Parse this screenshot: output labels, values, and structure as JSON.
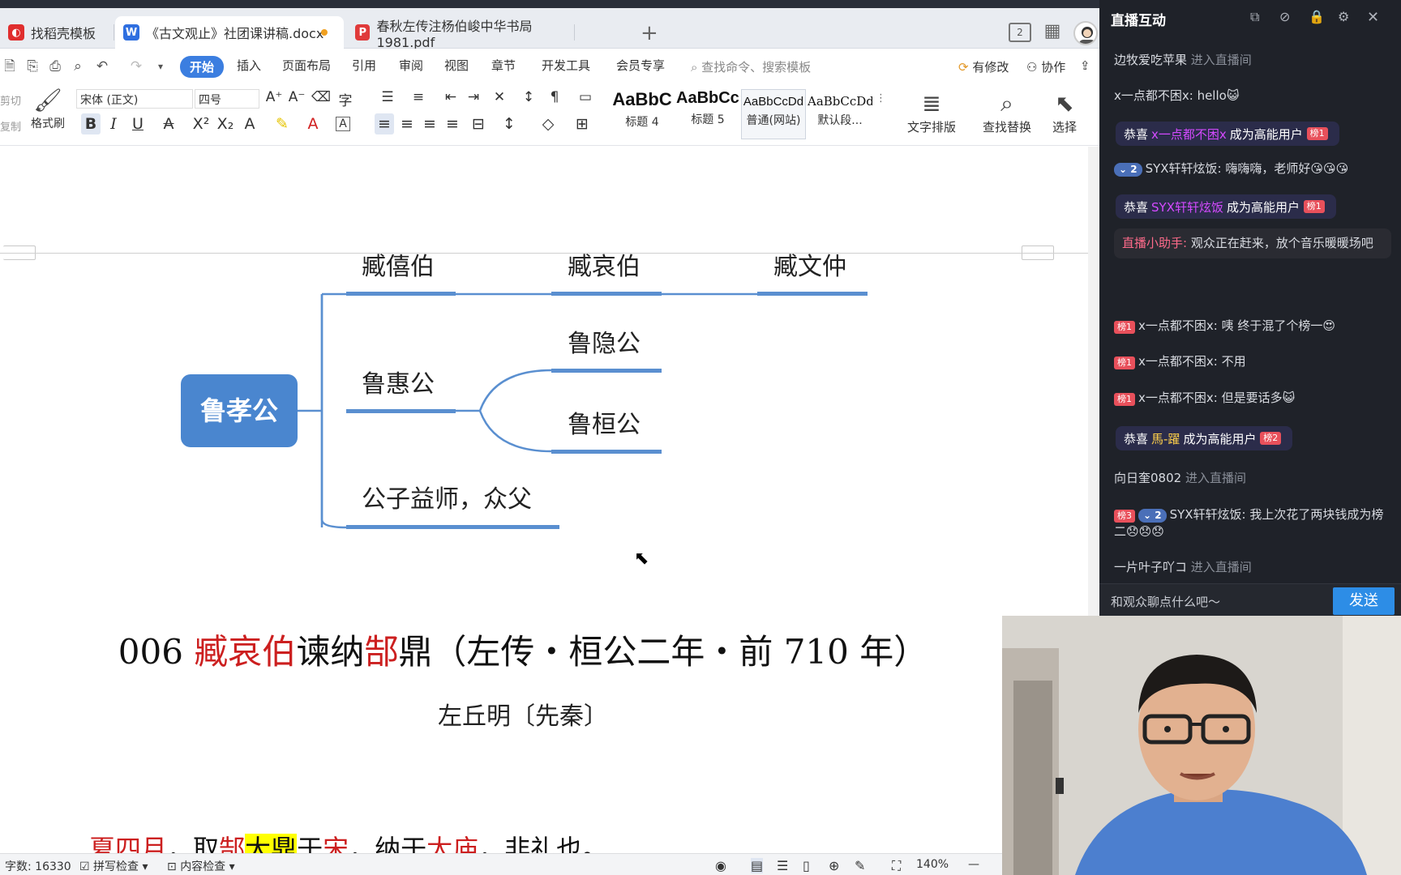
{
  "tabs": [
    {
      "label": "找稻壳模板",
      "icon_color": "#e02e2e",
      "icon": "稻"
    },
    {
      "label": "《古文观止》社团课讲稿.docx",
      "icon_color": "#2f6fe0",
      "icon": "W"
    },
    {
      "label": "春秋左传注杨伯峻中华书局1981.pdf",
      "icon_color": "#e03a3a",
      "icon": "P"
    }
  ],
  "new_tab": "+",
  "window_badge": "2",
  "menu": {
    "items": [
      "开始",
      "插入",
      "页面布局",
      "引用",
      "审阅",
      "视图",
      "章节",
      "开发工具",
      "会员专享"
    ],
    "search_placeholder": "查找命令、搜索模板",
    "modify": "有修改",
    "collab": "协作"
  },
  "ribbon": {
    "cut": "剪切",
    "copy": "复制",
    "format_painter": "格式刷",
    "font_name": "宋体 (正文)",
    "font_size": "四号",
    "styles": [
      {
        "sample": "AaBbC",
        "name": "标题 4"
      },
      {
        "sample": "AaBbCcI",
        "name": "标题 5"
      },
      {
        "sample": "AaBbCcDd",
        "name": "普通(网站)"
      },
      {
        "sample": "AaBbCcDd",
        "name": "默认段..."
      }
    ],
    "text_layout": "文字排版",
    "find_replace": "查找替换",
    "select": "选择"
  },
  "mindmap": {
    "root": "鲁孝公",
    "branches": [
      "臧僖伯",
      "臧哀伯",
      "臧文仲",
      "鲁惠公",
      "鲁隐公",
      "鲁桓公",
      "公子益师，众父"
    ],
    "root_color": "#4a86cf",
    "line_color": "#5a8fd0"
  },
  "document": {
    "title_parts": [
      {
        "text": "006 ",
        "red": false
      },
      {
        "text": "臧哀伯",
        "red": true
      },
      {
        "text": "谏纳",
        "red": false
      },
      {
        "text": "郜",
        "red": true
      },
      {
        "text": "鼎（左传・桓公二年・前 710 年）",
        "red": false
      }
    ],
    "author": "左丘明〔先秦〕",
    "body_parts": [
      {
        "text": "夏四月",
        "style": "red"
      },
      {
        "text": "，取",
        "style": ""
      },
      {
        "text": "郜",
        "style": "red"
      },
      {
        "text": "大鼎",
        "style": "hl"
      },
      {
        "text": "于",
        "style": ""
      },
      {
        "text": "宋",
        "style": "red"
      },
      {
        "text": "，纳于",
        "style": ""
      },
      {
        "text": "太庙",
        "style": "red"
      },
      {
        "text": "，非礼也。",
        "style": ""
      }
    ]
  },
  "status": {
    "word_count": "字数: 16330",
    "spell_check": "拼写检查",
    "content_check": "内容检查",
    "zoom": "140%"
  },
  "live": {
    "title": "直播互动",
    "messages": [
      {
        "kind": "enter",
        "user": "边牧爱吃苹果",
        "text": "进入直播间"
      },
      {
        "kind": "chat",
        "text": "x一点都不困x: hello😺"
      },
      {
        "kind": "pill",
        "pre": "恭喜",
        "user": "x一点都不困x",
        "post": "成为高能用户",
        "badge": "榜1"
      },
      {
        "kind": "chat",
        "vbadge": "2",
        "text": "SYX轩轩炫饭: 嗨嗨嗨，老师好😘😘😘"
      },
      {
        "kind": "pill",
        "pre": "恭喜",
        "user": "SYX轩轩炫饭",
        "post": "成为高能用户",
        "badge": "榜1"
      },
      {
        "kind": "notice",
        "head": "直播小助手:",
        "text": "观众正在赶来，放个音乐暖暖场吧"
      },
      {
        "kind": "chat",
        "badge": "榜1",
        "text": "x一点都不困x: 咦 终于混了个榜一😍"
      },
      {
        "kind": "chat",
        "badge": "榜1",
        "text": "x一点都不困x: 不用"
      },
      {
        "kind": "chat",
        "badge": "榜1",
        "text": "x一点都不困x: 但是要话多😺"
      },
      {
        "kind": "pill",
        "pre": "恭喜",
        "user": "馬-躍",
        "post": "成为高能用户",
        "badge": "榜2"
      },
      {
        "kind": "enter",
        "user": "向日奎0802",
        "text": "进入直播间"
      },
      {
        "kind": "chat",
        "badge": "榜3",
        "vbadge": "2",
        "text": "SYX轩轩炫饭: 我上次花了两块钱成为榜二😞😞😞"
      },
      {
        "kind": "enter",
        "user": "一片叶子吖コ",
        "text": "进入直播间"
      }
    ],
    "input_placeholder": "和观众聊点什么吧～",
    "send": "发送"
  }
}
